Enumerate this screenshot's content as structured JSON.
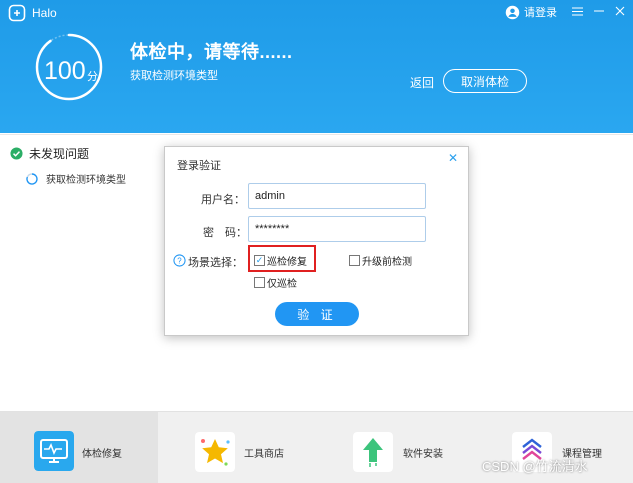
{
  "app": {
    "name": "Halo"
  },
  "titlebar": {
    "login_label": "请登录",
    "menu_icon": "menu-icon",
    "minimize_icon": "minimize-icon",
    "close_icon": "close-icon"
  },
  "header": {
    "score": "100",
    "score_unit": "分",
    "status_title": "体检中，请等待......",
    "status_sub": "获取检测环境类型",
    "back_label": "返回",
    "cancel_label": "取消体检",
    "progress": 0.9
  },
  "results": {
    "summary": "未发现问题",
    "detail": "获取检测环境类型"
  },
  "dialog": {
    "title": "登录验证",
    "username_label": "用户名：",
    "username_value": "admin",
    "password_label": "密　码：",
    "password_value": "********",
    "scene_label": "场景选择：",
    "options": [
      {
        "label": "巡检修复",
        "checked": true
      },
      {
        "label": "升级前检测",
        "checked": false
      },
      {
        "label": "仅巡检",
        "checked": false
      }
    ],
    "verify_label": "验 证"
  },
  "bottom_nav": [
    {
      "label": "体检修复",
      "icon": "monitor-heartbeat-icon",
      "active": true
    },
    {
      "label": "工具商店",
      "icon": "star-icon",
      "active": false
    },
    {
      "label": "软件安装",
      "icon": "arrow-up-icon",
      "active": false
    },
    {
      "label": "课程管理",
      "icon": "layers-icon",
      "active": false
    }
  ],
  "watermark": "CSDN @竹流清水",
  "colors": {
    "primary": "#2196f3",
    "header": "#1f9be8",
    "highlight": "#e02020",
    "success": "#2bae66"
  }
}
